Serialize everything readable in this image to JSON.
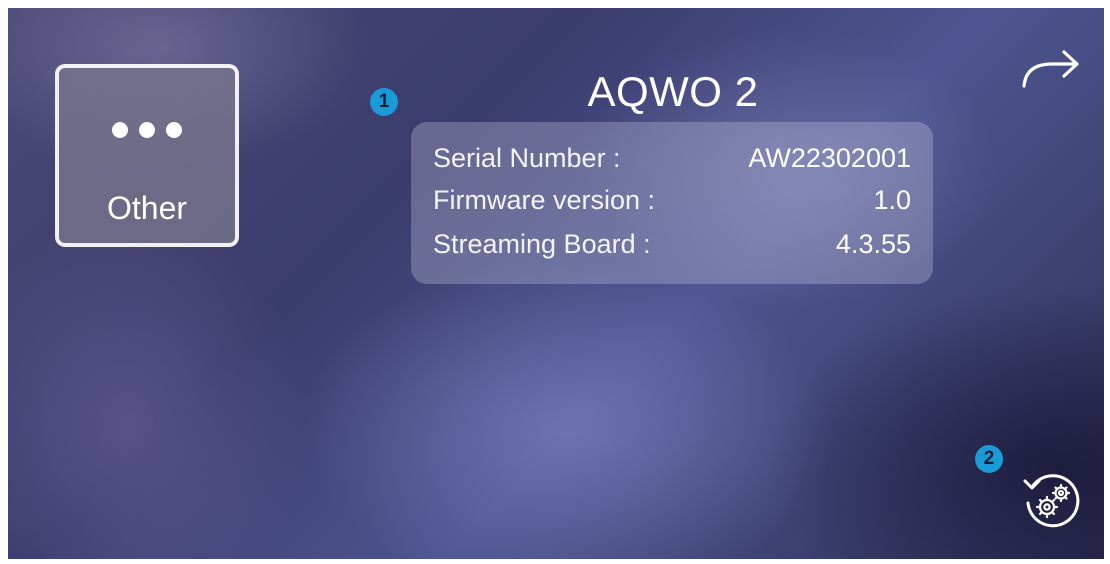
{
  "other_tile": {
    "label": "Other",
    "icon": "more-horizontal-icon"
  },
  "device": {
    "name": "AQWO 2",
    "info": [
      {
        "label": "Serial Number :",
        "value": "AW22302001"
      },
      {
        "label": "Firmware version :",
        "value": "1.0"
      },
      {
        "label": "Streaming Board :",
        "value": "4.3.55"
      }
    ]
  },
  "callouts": {
    "one": "1",
    "two": "2"
  },
  "icons": {
    "next": "arrow-right-icon",
    "reset": "settings-reset-icon"
  },
  "colors": {
    "callout": "#1a9ad6",
    "text": "#ffffff"
  }
}
